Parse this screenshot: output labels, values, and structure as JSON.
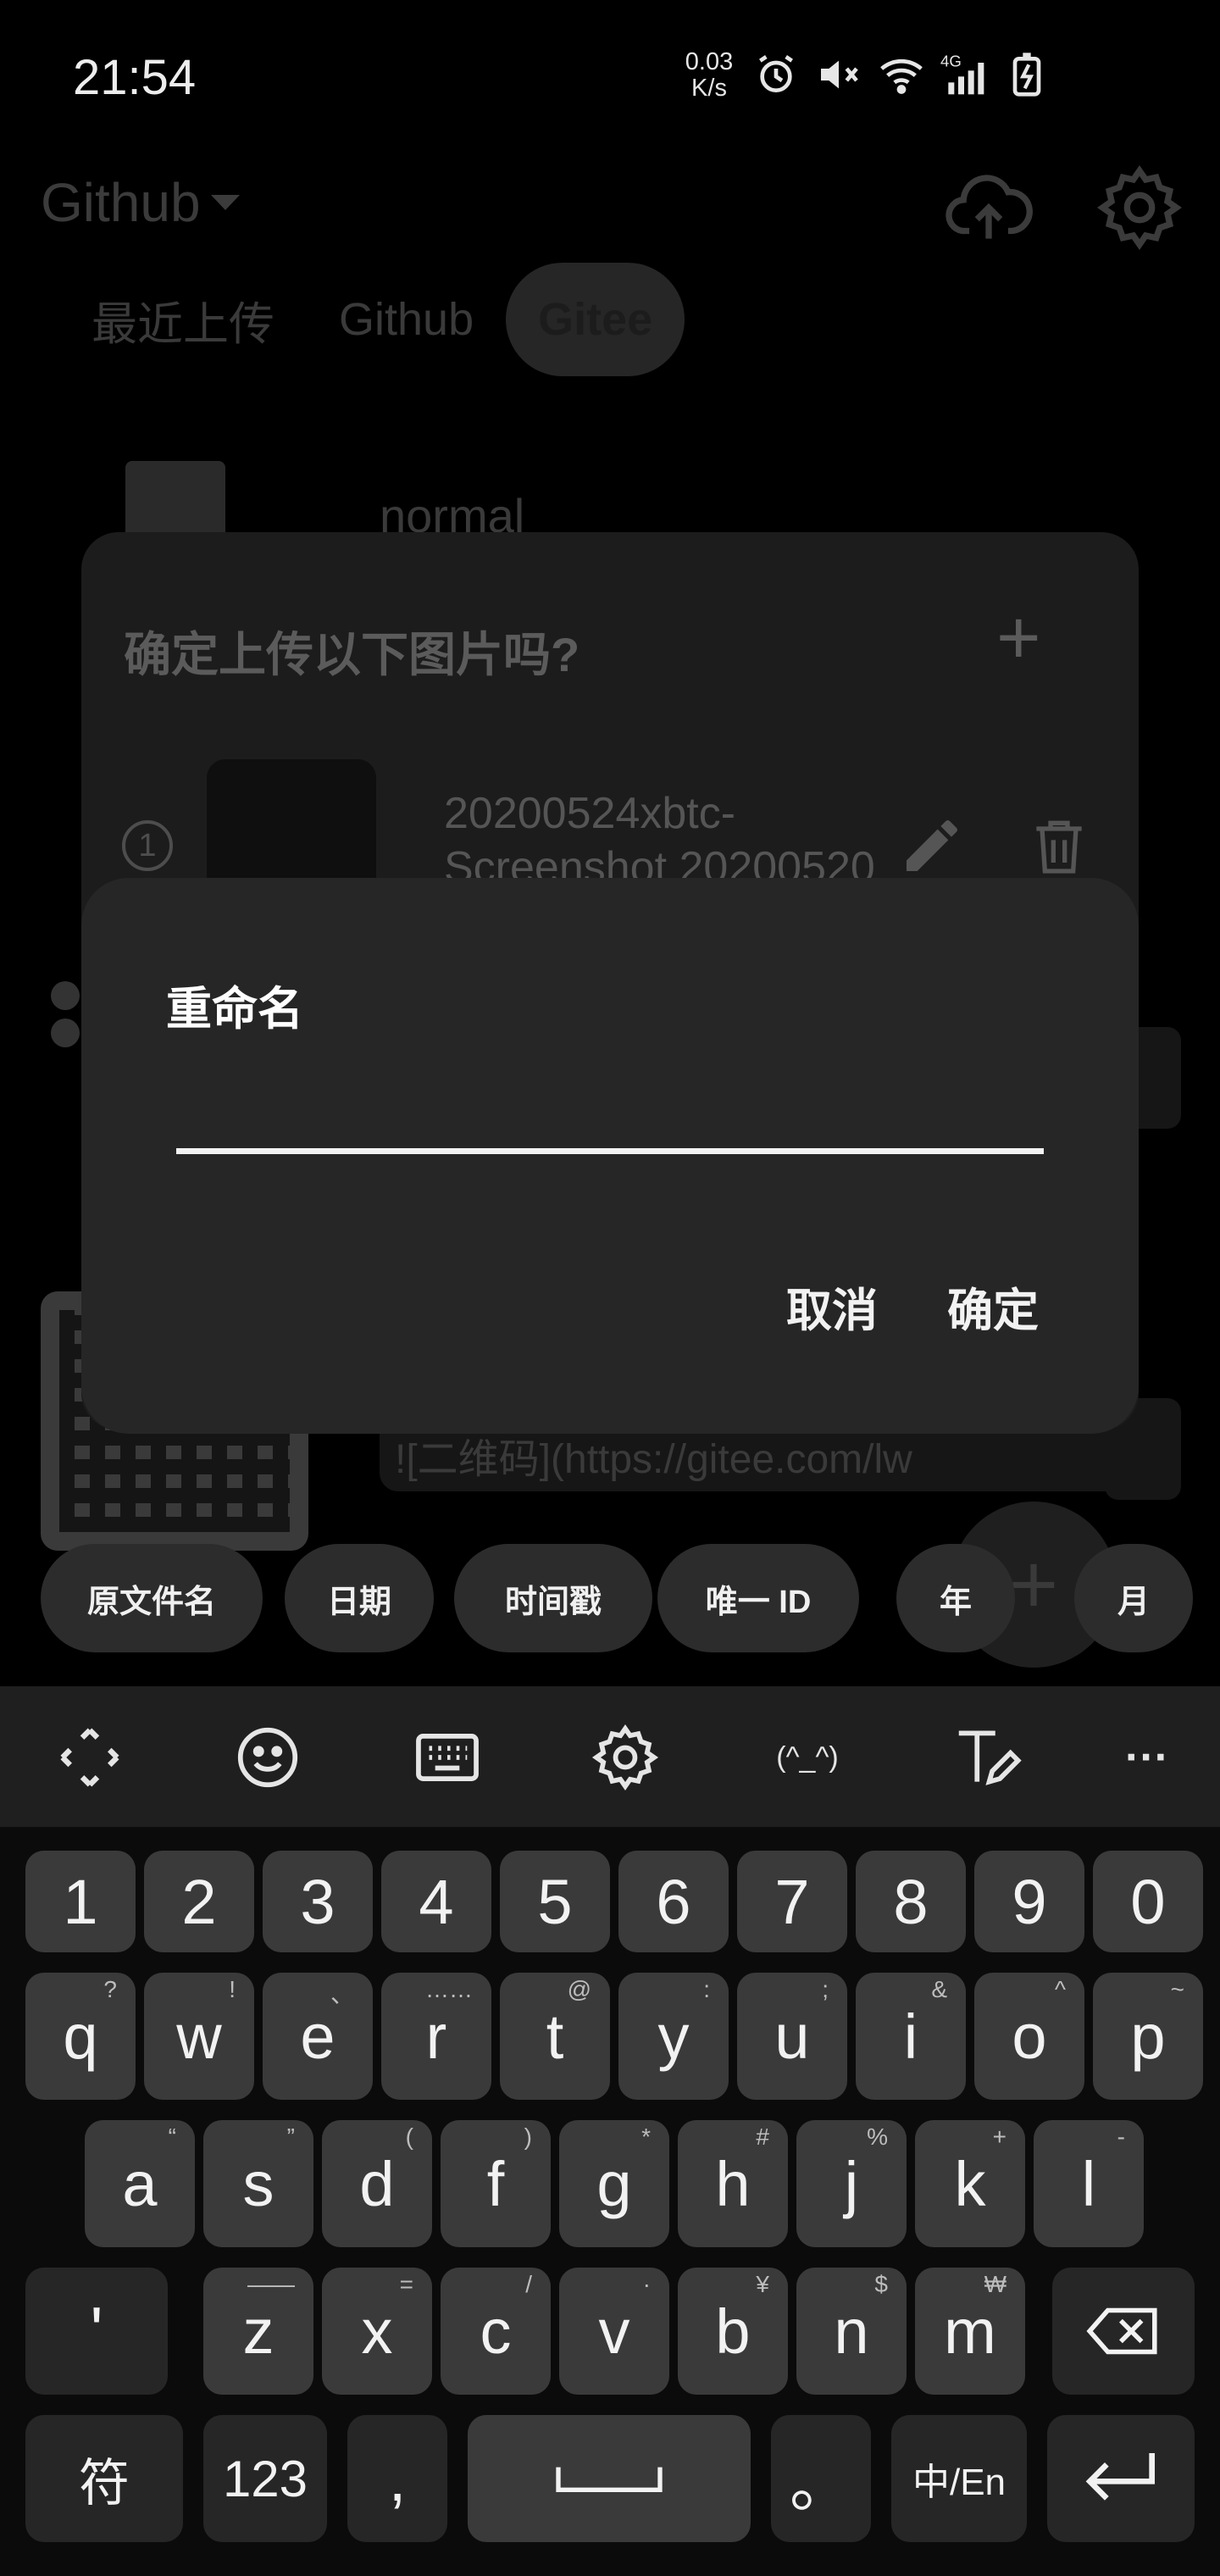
{
  "status_bar": {
    "time": "21:54",
    "net_speed_value": "0.03",
    "net_speed_unit": "K/s",
    "icons": [
      "alarm-icon",
      "mute-icon",
      "wifi-icon",
      "signal-4g-icon",
      "battery-charging-icon"
    ],
    "signal_label": "4G"
  },
  "app": {
    "title": "Github",
    "tabs": [
      "最近上传",
      "Github",
      "Gitee"
    ],
    "active_tab": "Gitee",
    "folder_name": "normal",
    "markdown_link": "![二维码](https://gitee.com/lw",
    "fab_label": "+"
  },
  "confirm_dialog": {
    "title": "确定上传以下图片吗?",
    "add_label": "+",
    "item_index": "1",
    "item_name": "20200524xbtc-Screenshot 20200520"
  },
  "rename_dialog": {
    "title": "重命名",
    "input_value": "",
    "cancel_label": "取消",
    "ok_label": "确定"
  },
  "name_chips": [
    "原文件名",
    "日期",
    "时间戳",
    "唯一 ID",
    "年",
    "月"
  ],
  "keyboard": {
    "toolbar_icons": [
      "move-cursor-icon",
      "emoji-icon",
      "keyboard-icon",
      "settings-icon",
      "kaomoji-icon",
      "handwriting-icon",
      "more-icon"
    ],
    "kaomoji_label": "(^_^)",
    "more_label": "···",
    "number_row": [
      "1",
      "2",
      "3",
      "4",
      "5",
      "6",
      "7",
      "8",
      "9",
      "0"
    ],
    "row1": [
      {
        "key": "q",
        "hint": "?"
      },
      {
        "key": "w",
        "hint": "!"
      },
      {
        "key": "e",
        "hint": "、"
      },
      {
        "key": "r",
        "hint": "……"
      },
      {
        "key": "t",
        "hint": "@"
      },
      {
        "key": "y",
        "hint": ":"
      },
      {
        "key": "u",
        "hint": ";"
      },
      {
        "key": "i",
        "hint": "&"
      },
      {
        "key": "o",
        "hint": "^"
      },
      {
        "key": "p",
        "hint": "~"
      }
    ],
    "row2": [
      {
        "key": "a",
        "hint": "“"
      },
      {
        "key": "s",
        "hint": "”"
      },
      {
        "key": "d",
        "hint": "("
      },
      {
        "key": "f",
        "hint": ")"
      },
      {
        "key": "g",
        "hint": "*"
      },
      {
        "key": "h",
        "hint": "#"
      },
      {
        "key": "j",
        "hint": "%"
      },
      {
        "key": "k",
        "hint": "+"
      },
      {
        "key": "l",
        "hint": "-"
      }
    ],
    "row3": [
      {
        "key": "z",
        "hint": "——"
      },
      {
        "key": "x",
        "hint": "="
      },
      {
        "key": "c",
        "hint": "/"
      },
      {
        "key": "v",
        "hint": "·"
      },
      {
        "key": "b",
        "hint": "¥"
      },
      {
        "key": "n",
        "hint": "$"
      },
      {
        "key": "m",
        "hint": "₩"
      }
    ],
    "apostrophe": "'",
    "symbols_label": "符",
    "numbers_label": "123",
    "comma_label": ",",
    "period_label": "。",
    "lang_label": "中/En"
  }
}
